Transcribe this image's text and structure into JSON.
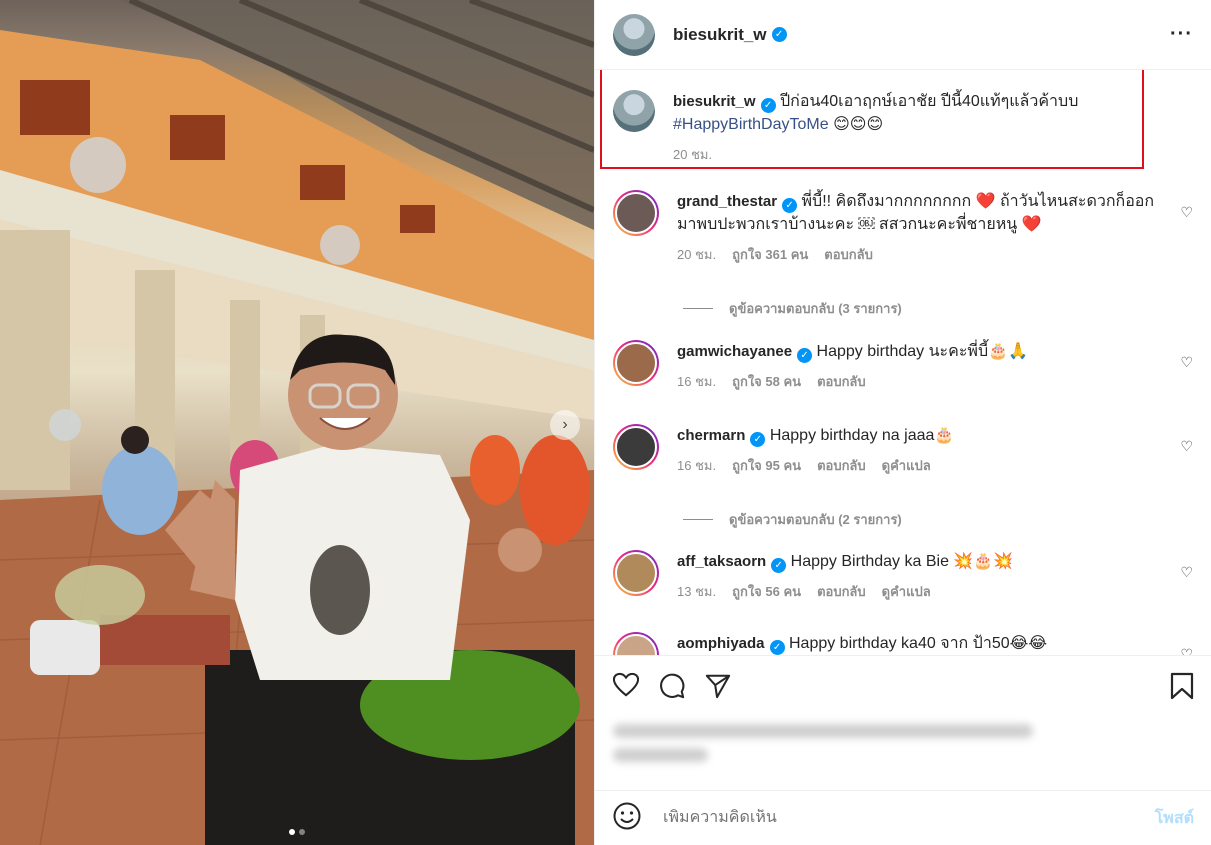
{
  "post": {
    "author": "biesukrit_w",
    "caption_line1": "ปีก่อน40เอาฤกษ์เอาชัย ปีนี้40แท้ๆแล้วค้าบบ",
    "hashtag": "#HappyBirthDayToMe",
    "caption_emoji": "😊😊😊",
    "time": "20 ชม."
  },
  "comments": [
    {
      "user": "grand_thestar",
      "text": "พี่บี้!! คิดถึงมากกกกกกกก ❤️ ถ้าวันไหนสะดวกก็ออกมาพบปะพวกเราบ้างนะคะ ￼ สสวกนะคะพี่ชายหนู ❤️",
      "time": "20 ชม.",
      "likes": "ถูกใจ 361 คน",
      "reply": "ตอบกลับ",
      "translate": ""
    },
    {
      "user": "gamwichayanee",
      "text": "Happy birthday นะคะพี่บี้🎂🙏",
      "time": "16 ชม.",
      "likes": "ถูกใจ 58 คน",
      "reply": "ตอบกลับ",
      "translate": ""
    },
    {
      "user": "chermarn",
      "text": "Happy birthday na jaaa🎂",
      "time": "16 ชม.",
      "likes": "ถูกใจ 95 คน",
      "reply": "ตอบกลับ",
      "translate": "ดูคำแปล"
    },
    {
      "user": "aff_taksaorn",
      "text": "Happy Birthday ka Bie 💥🎂💥",
      "time": "13 ชม.",
      "likes": "ถูกใจ 56 คน",
      "reply": "ตอบกลับ",
      "translate": "ดูคำแปล"
    },
    {
      "user": "aomphiyada",
      "text": "Happy birthday ka40 จาก ป้า50😂😂",
      "time": "",
      "likes": "",
      "reply": "",
      "translate": ""
    }
  ],
  "view_replies": [
    "ดูข้อความตอบกลับ (3 รายการ)",
    "ดูข้อความตอบกลับ (2 รายการ)"
  ],
  "composer": {
    "placeholder": "เพิ่มความคิดเห็น",
    "post_label": "โพสต์"
  },
  "colors": {
    "verified": "#0095f6",
    "highlight_border": "#e0101a",
    "hashtag": "#385185",
    "post_button": "#b2dffc"
  },
  "icons": [
    "heart-icon",
    "comment-icon",
    "share-icon",
    "bookmark-icon",
    "emoji-icon",
    "more-icon",
    "verified-badge-icon"
  ],
  "carousel": {
    "slides": 2,
    "active": 1
  }
}
